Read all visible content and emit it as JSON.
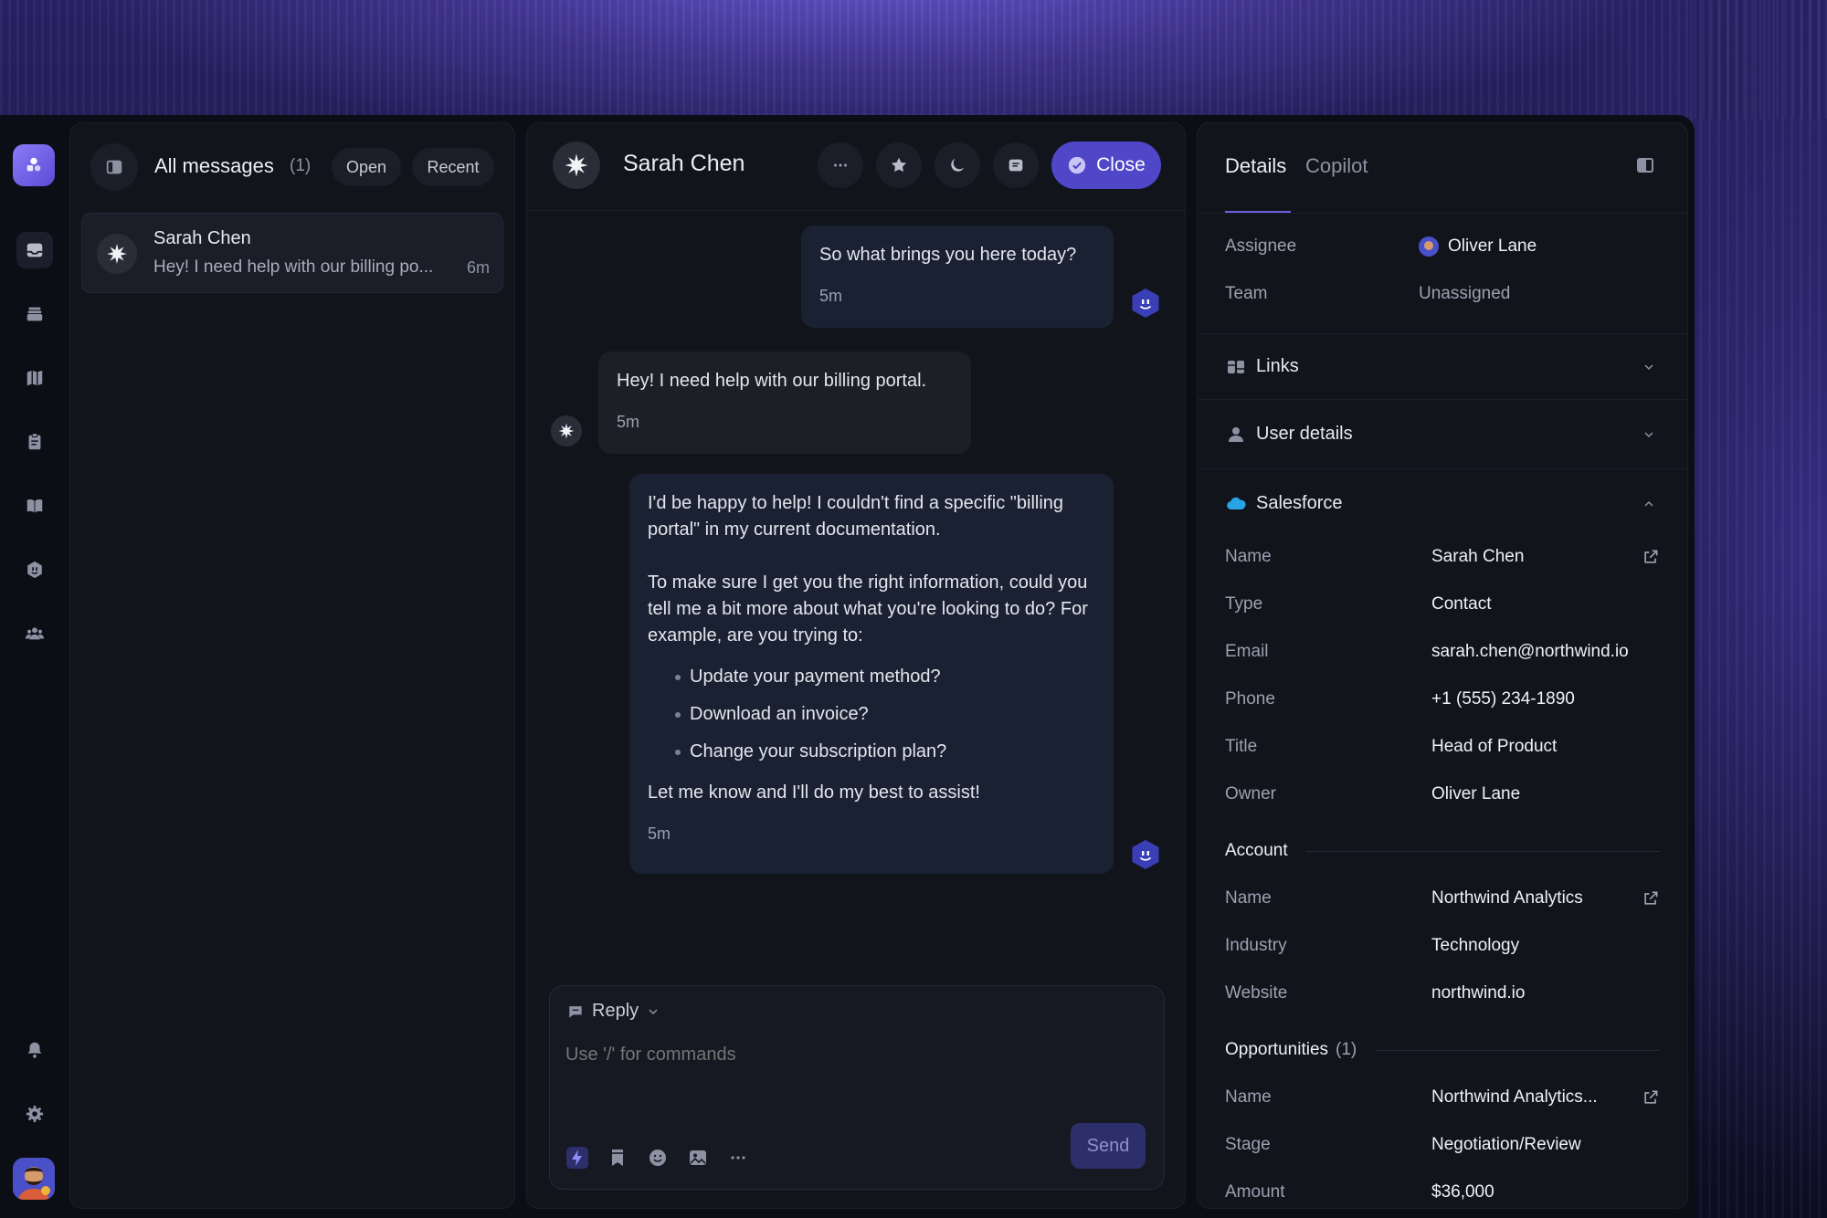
{
  "list": {
    "title": "All messages",
    "count": "(1)",
    "filter_open": "Open",
    "filter_recent": "Recent",
    "conversations": [
      {
        "name": "Sarah Chen",
        "preview": "Hey! I need help with our billing po...",
        "time": "6m"
      }
    ]
  },
  "chat": {
    "contact_name": "Sarah Chen",
    "close_label": "Close",
    "messages": [
      {
        "from": "agent",
        "text": "So what brings you here today?",
        "time": "5m"
      },
      {
        "from": "user",
        "text": "Hey! I need help with our billing portal.",
        "time": "5m"
      },
      {
        "from": "agent",
        "p1": "I'd be happy to help! I couldn't find a specific \"billing portal\" in my current documentation.",
        "p2": "To make sure I get you the right information, could you tell me a bit more about what you're looking to do? For example, are you trying to:",
        "bullets": [
          "Update your payment method?",
          "Download an invoice?",
          "Change your subscription plan?"
        ],
        "p3": "Let me know and I'll do my best to assist!",
        "time": "5m"
      }
    ],
    "composer": {
      "mode": "Reply",
      "placeholder": "Use '/' for commands",
      "send_label": "Send"
    }
  },
  "details": {
    "tab_details": "Details",
    "tab_copilot": "Copilot",
    "assignee_label": "Assignee",
    "assignee_value": "Oliver Lane",
    "team_label": "Team",
    "team_value": "Unassigned",
    "links_label": "Links",
    "user_details_label": "User details",
    "salesforce_label": "Salesforce",
    "contact": [
      {
        "k": "Name",
        "v": "Sarah Chen"
      },
      {
        "k": "Type",
        "v": "Contact"
      },
      {
        "k": "Email",
        "v": "sarah.chen@northwind.io"
      },
      {
        "k": "Phone",
        "v": "+1 (555) 234-1890"
      },
      {
        "k": "Title",
        "v": "Head of Product"
      },
      {
        "k": "Owner",
        "v": "Oliver Lane"
      }
    ],
    "account_label": "Account",
    "account": [
      {
        "k": "Name",
        "v": "Northwind Analytics"
      },
      {
        "k": "Industry",
        "v": "Technology"
      },
      {
        "k": "Website",
        "v": "northwind.io"
      }
    ],
    "opportunities_label": "Opportunities",
    "opportunities_count": "(1)",
    "opportunity": [
      {
        "k": "Name",
        "v": "Northwind Analytics..."
      },
      {
        "k": "Stage",
        "v": "Negotiation/Review"
      },
      {
        "k": "Amount",
        "v": "$36,000"
      }
    ]
  },
  "colors": {
    "accent": "#4f46c8",
    "salesforce": "#27a3e6",
    "panel": "#12141c",
    "bubble_agent": "#1a2132",
    "bubble_user": "#1d1f27"
  }
}
